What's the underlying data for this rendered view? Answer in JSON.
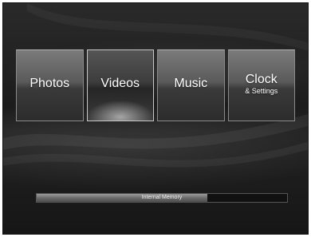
{
  "menu": {
    "items": [
      {
        "label": "Photos",
        "sub": ""
      },
      {
        "label": "Videos",
        "sub": ""
      },
      {
        "label": "Music",
        "sub": ""
      },
      {
        "label": "Clock",
        "sub": "& Settings"
      }
    ],
    "selected_index": 1
  },
  "memory": {
    "label": "Internal Memory",
    "used_fraction": 0.68
  }
}
